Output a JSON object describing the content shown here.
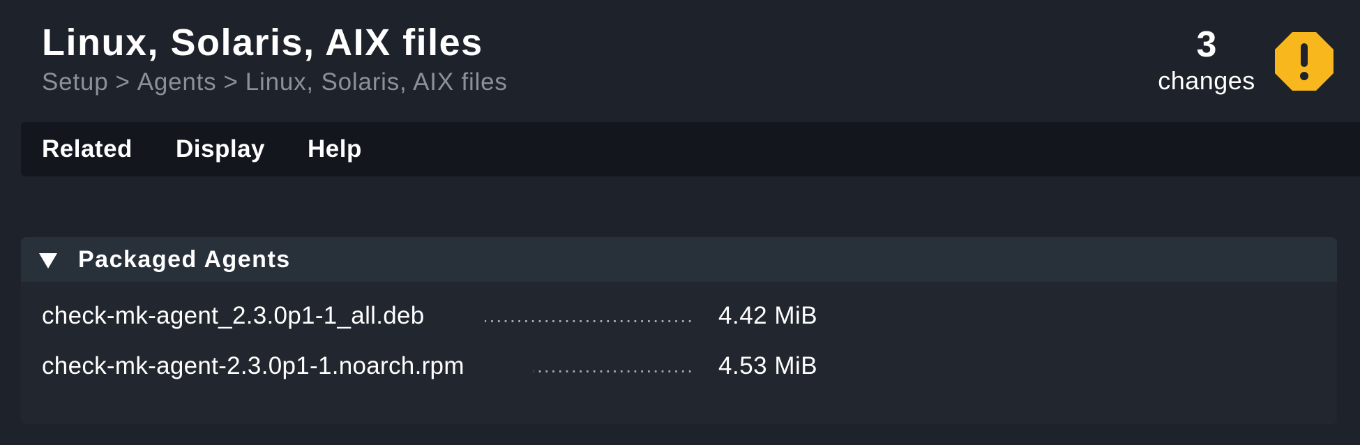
{
  "header": {
    "title": "Linux, Solaris, AIX files",
    "breadcrumb": [
      "Setup",
      "Agents",
      "Linux, Solaris, AIX files"
    ],
    "breadcrumb_separator": ">"
  },
  "changes": {
    "count": "3",
    "label": "changes",
    "icon": "warning-octagon-icon",
    "icon_color": "#f8b81d"
  },
  "menu": {
    "items": [
      "Related",
      "Display",
      "Help"
    ]
  },
  "panel": {
    "title": "Packaged Agents",
    "files": [
      {
        "name": "check-mk-agent_2.3.0p1-1_all.deb",
        "size": "4.42 MiB"
      },
      {
        "name": "check-mk-agent-2.3.0p1-1.noarch.rpm",
        "size": "4.53 MiB"
      }
    ]
  }
}
